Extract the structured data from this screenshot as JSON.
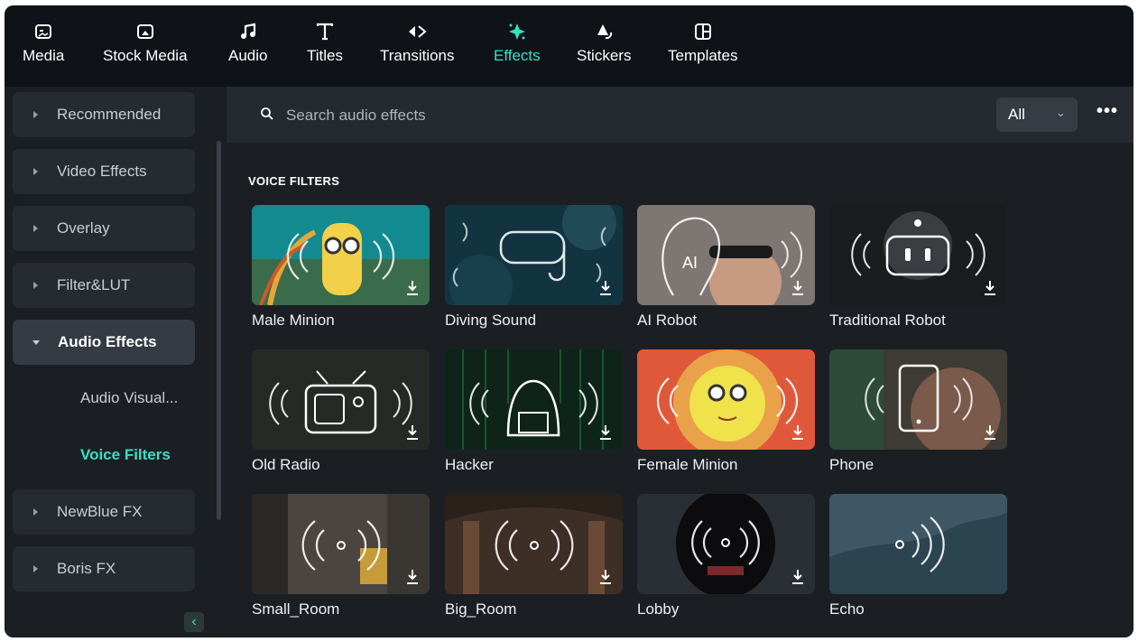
{
  "toolbar": {
    "items": [
      {
        "label": "Media",
        "icon": "media-icon",
        "active": false
      },
      {
        "label": "Stock Media",
        "icon": "stock-media-icon",
        "active": false
      },
      {
        "label": "Audio",
        "icon": "music-note-icon",
        "active": false
      },
      {
        "label": "Titles",
        "icon": "text-t-icon",
        "active": false
      },
      {
        "label": "Transitions",
        "icon": "transitions-icon",
        "active": false
      },
      {
        "label": "Effects",
        "icon": "sparkle-icon",
        "active": true
      },
      {
        "label": "Stickers",
        "icon": "stickers-icon",
        "active": false
      },
      {
        "label": "Templates",
        "icon": "templates-icon",
        "active": false
      }
    ]
  },
  "sidebar": {
    "items": [
      {
        "label": "Recommended"
      },
      {
        "label": "Video Effects"
      },
      {
        "label": "Overlay"
      },
      {
        "label": "Filter&LUT"
      },
      {
        "label": "Audio Effects",
        "expanded": true
      },
      {
        "label": "NewBlue FX"
      },
      {
        "label": "Boris FX"
      }
    ],
    "subitems": [
      {
        "label": "Audio Visual...",
        "active": false
      },
      {
        "label": "Voice Filters",
        "active": true
      }
    ],
    "collapse_glyph": "‹"
  },
  "search": {
    "placeholder": "Search audio effects",
    "value": ""
  },
  "filter": {
    "selected": "All",
    "chevron": "⌄"
  },
  "more_glyph": "•••",
  "section": {
    "title": "VOICE FILTERS"
  },
  "effects": [
    {
      "name": "Male Minion",
      "thumb": "male-minion-thumbnail"
    },
    {
      "name": "Diving Sound",
      "thumb": "diving-sound-thumbnail"
    },
    {
      "name": "AI Robot",
      "thumb": "ai-robot-thumbnail",
      "badge": "AI"
    },
    {
      "name": "Traditional Robot",
      "thumb": "traditional-robot-thumbnail"
    },
    {
      "name": "Old Radio",
      "thumb": "old-radio-thumbnail"
    },
    {
      "name": "Hacker",
      "thumb": "hacker-thumbnail"
    },
    {
      "name": "Female Minion",
      "thumb": "female-minion-thumbnail"
    },
    {
      "name": "Phone",
      "thumb": "phone-thumbnail"
    },
    {
      "name": "Small_Room",
      "thumb": "small-room-thumbnail"
    },
    {
      "name": "Big_Room",
      "thumb": "big-room-thumbnail"
    },
    {
      "name": "Lobby",
      "thumb": "lobby-thumbnail"
    },
    {
      "name": "Echo",
      "thumb": "echo-thumbnail"
    }
  ],
  "colors": {
    "accent": "#35e0c7",
    "toolbar_bg": "#0f1318",
    "panel_bg": "#1b1f24",
    "sidebar_item_bg": "#262b31"
  }
}
